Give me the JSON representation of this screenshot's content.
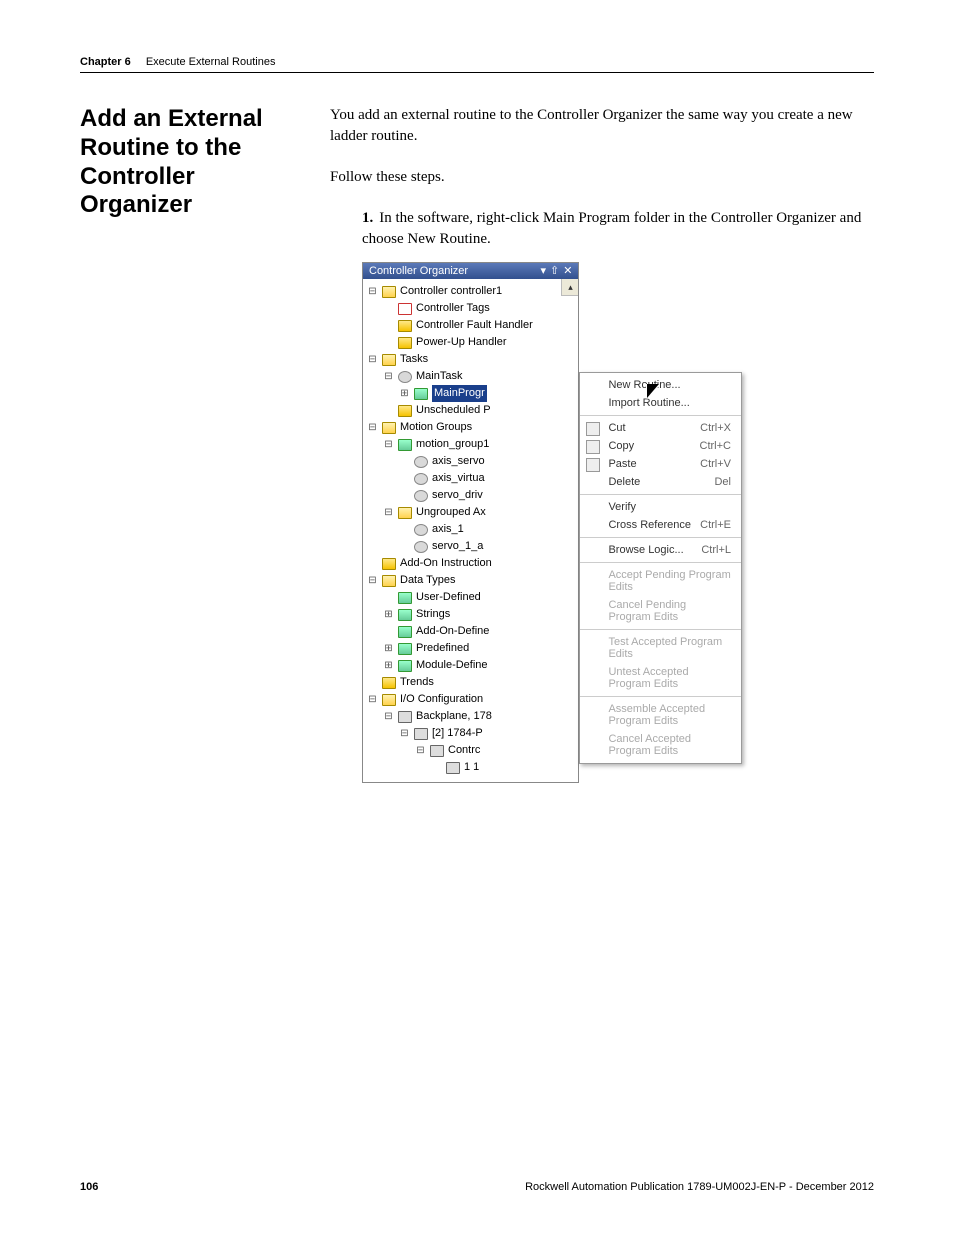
{
  "header": {
    "chapter": "Chapter 6",
    "title": "Execute External Routines"
  },
  "section_heading": "Add an External Routine to the Controller Organizer",
  "intro_para": "You add an external routine to the Controller Organizer the same way you create a new ladder routine.",
  "follow": "Follow these steps.",
  "steps": [
    {
      "num": "1.",
      "text": "In the software, right-click Main Program folder in the Controller Organizer and choose New Routine."
    }
  ],
  "pane": {
    "title": "Controller Organizer",
    "tree": {
      "controller": "Controller controller1",
      "tags": "Controller Tags",
      "fault": "Controller Fault Handler",
      "powerup": "Power-Up Handler",
      "tasks": "Tasks",
      "maintask": "MainTask",
      "mainprog": "MainProgr",
      "unsched": "Unscheduled P",
      "motion": "Motion Groups",
      "mgroup1": "motion_group1",
      "axis_servo": "axis_servo",
      "axis_virtual": "axis_virtua",
      "servo_driv": "servo_driv",
      "ungrouped": "Ungrouped Ax",
      "axis1": "axis_1",
      "servo_1a": "servo_1_a",
      "addon": "Add-On Instruction",
      "datatypes": "Data Types",
      "userdef": "User-Defined",
      "strings": "Strings",
      "addondef": "Add-On-Define",
      "predef": "Predefined",
      "moddef": "Module-Define",
      "trends": "Trends",
      "ioconf": "I/O Configuration",
      "backplane": "Backplane, 178",
      "slot2": "[2] 1784-P",
      "contrc": "Contrc",
      "oneone": "1 1"
    }
  },
  "ctx": {
    "groups": [
      [
        {
          "label": "New Routine...",
          "hl": true
        },
        {
          "label": "Import Routine..."
        }
      ],
      [
        {
          "label": "Cut",
          "sc": "Ctrl+X",
          "icn": true
        },
        {
          "label": "Copy",
          "sc": "Ctrl+C",
          "icn": true
        },
        {
          "label": "Paste",
          "sc": "Ctrl+V",
          "icn": true
        },
        {
          "label": "Delete",
          "sc": "Del"
        }
      ],
      [
        {
          "label": "Verify"
        },
        {
          "label": "Cross Reference",
          "sc": "Ctrl+E"
        }
      ],
      [
        {
          "label": "Browse Logic...",
          "sc": "Ctrl+L"
        }
      ],
      [
        {
          "label": "Accept Pending Program Edits",
          "disabled": true
        },
        {
          "label": "Cancel Pending Program Edits",
          "disabled": true
        }
      ],
      [
        {
          "label": "Test Accepted Program Edits",
          "disabled": true
        },
        {
          "label": "Untest Accepted Program Edits",
          "disabled": true
        }
      ],
      [
        {
          "label": "Assemble Accepted Program Edits",
          "disabled": true
        },
        {
          "label": "Cancel Accepted Program Edits",
          "disabled": true
        }
      ]
    ]
  },
  "footer": {
    "pagenum": "106",
    "pub": "Rockwell Automation Publication 1789-UM002J-EN-P - December 2012"
  }
}
